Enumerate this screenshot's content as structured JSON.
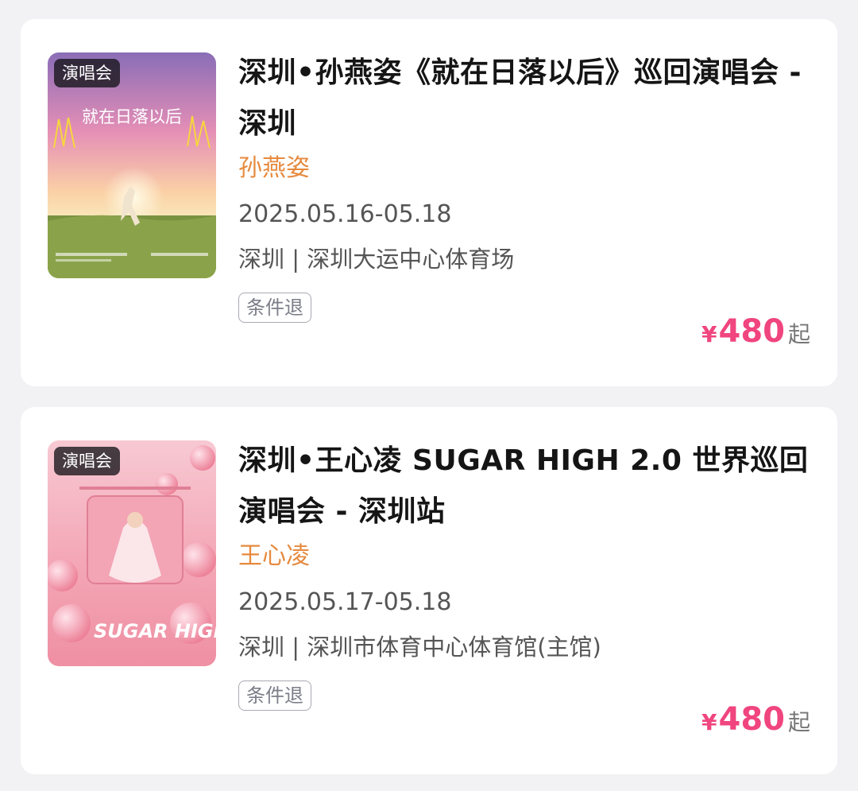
{
  "events": [
    {
      "tag": "演唱会",
      "title": "深圳•孙燕姿《就在日落以后》巡回演唱会 - 深圳",
      "artist": "孙燕姿",
      "date": "2025.05.16-05.18",
      "venue": "深圳 | 深圳大运中心体育场",
      "refund_label": "条件退",
      "price_currency": "¥",
      "price_value": "480",
      "price_suffix": "起",
      "poster_text": "就在日落以后"
    },
    {
      "tag": "演唱会",
      "title": "深圳•王心凌 SUGAR HIGH 2.0 世界巡回演唱会 - 深圳站",
      "artist": "王心凌",
      "date": "2025.05.17-05.18",
      "venue": "深圳 | 深圳市体育中心体育馆(主馆)",
      "refund_label": "条件退",
      "price_currency": "¥",
      "price_value": "480",
      "price_suffix": "起",
      "poster_text": "SUGAR HIGH"
    }
  ],
  "colors": {
    "artist": "#e68a3e",
    "price": "#f0457f",
    "background": "#f2f2f4"
  }
}
